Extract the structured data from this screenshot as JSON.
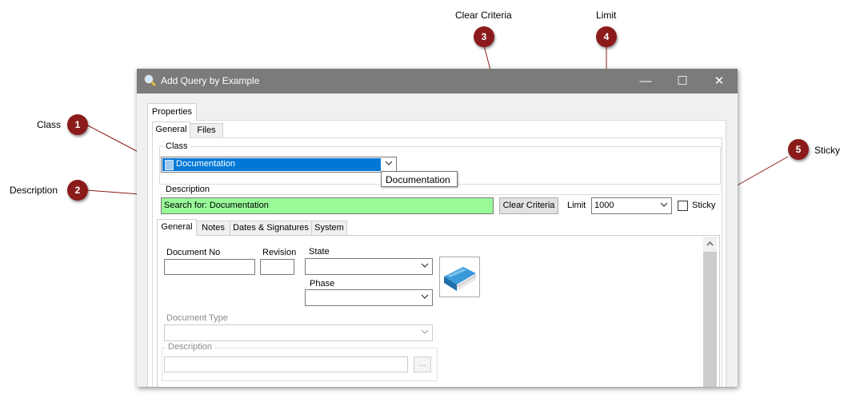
{
  "callouts": [
    {
      "num": "1",
      "label": "Class"
    },
    {
      "num": "2",
      "label": "Description"
    },
    {
      "num": "3",
      "label": "Clear Criteria"
    },
    {
      "num": "4",
      "label": "Limit"
    },
    {
      "num": "5",
      "label": "Sticky"
    }
  ],
  "window": {
    "title": "Add Query by Example",
    "minimize_glyph": "—",
    "maximize_glyph": "☐",
    "close_glyph": "✕"
  },
  "tabs_top": [
    "Properties"
  ],
  "tabs_second": [
    "General",
    "Files"
  ],
  "class_group": {
    "title": "Class",
    "selected": "Documentation",
    "tooltip": "Documentation"
  },
  "description_group": {
    "title": "Description",
    "value": "Search for: Documentation",
    "clear_button": "Clear Criteria",
    "limit_label": "Limit",
    "limit_value": "1000",
    "sticky_label": "Sticky"
  },
  "inner_tabs": [
    "General",
    "Notes",
    "Dates & Signatures",
    "System"
  ],
  "form": {
    "document_no_label": "Document No",
    "revision_label": "Revision",
    "state_label": "State",
    "phase_label": "Phase",
    "document_type_label": "Document Type",
    "description_label": "Description",
    "ellipsis": "..."
  },
  "colors": {
    "badge": "#8b1b1b",
    "titlebar": "#7b7b7b",
    "selected_item": "#0078d7",
    "description_fill": "#98fb98",
    "book_icon": "#2e86c1"
  },
  "icons": {
    "window_icon": "magnifier-icon",
    "class_item_icon": "document-icon",
    "preview_icon": "book-icon"
  }
}
